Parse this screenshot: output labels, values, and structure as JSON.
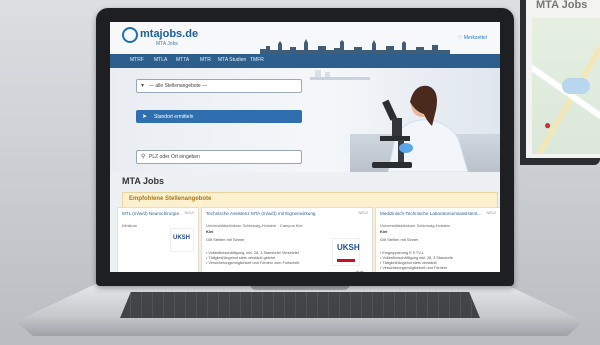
{
  "bg_monitor": {
    "title": "MTA Jobs",
    "map_pin_icon": "map-pin-icon"
  },
  "header": {
    "logo_text": "mtajobs.de",
    "logo_sub": "MTA Jobs",
    "notepad_link": "♡ Merkzettel"
  },
  "nav": {
    "items": [
      "MTRF",
      "MTLA",
      "MTTA",
      "MTR",
      "MTA Studien",
      "TMFR"
    ]
  },
  "search": {
    "category_placeholder": "— alle Stellenangebote —",
    "locate_button": "Standort ermitteln",
    "zip_placeholder": "PLZ oder Ort eingeben"
  },
  "page_title": "MTA Jobs",
  "recommended": {
    "title": "Empfohlene Stellenangebote",
    "cards": [
      {
        "title": "MTL (m/w/d) Neurochirurgie",
        "subtitle": "Klinikum",
        "city": "",
        "meta": "",
        "lines": "",
        "new": "NEU!",
        "logo": "UKSH"
      },
      {
        "title": "Technische Assistenz MTA (m/w/d) mit Eignenwirkung",
        "subtitle": "Universitätsklinikum Schleswig-Holstein · Campus Kiel",
        "city": "Kiel",
        "meta": "Gilt Stellen mit Sinner",
        "lines": "• Vollzeitbeschäftigung, inkl. 28, 3 Standorte/ Versetzter\n• Tätigkeit/Angebot stets verstärkt gelehrt\n• Versicherungsmöglichkeit und Fördern zum Fortschritt",
        "new": "NEU!",
        "logo": "UKSH"
      },
      {
        "title": "Medizinisch-Technische Laboratoriumsassistent…",
        "subtitle": "Universitätsklinikum Schleswig-Holstein",
        "city": "Kiel",
        "meta": "Gilt Stellen mit Sinner",
        "lines": "• Eingruppierung E 9 TV-L\n• Vollzeitbeschäftigung inkl. 28, 3 Standorte\n• Tätigkeit/Angebot stets verstärkt\n• Versicherungsmöglichkeit und Fördern",
        "new": "NEU!",
        "logo": ""
      }
    ]
  },
  "colors": {
    "brand_blue": "#2d5f8c",
    "accent_blue": "#2f6fb0",
    "panel_bg": "#fbf1cf"
  }
}
